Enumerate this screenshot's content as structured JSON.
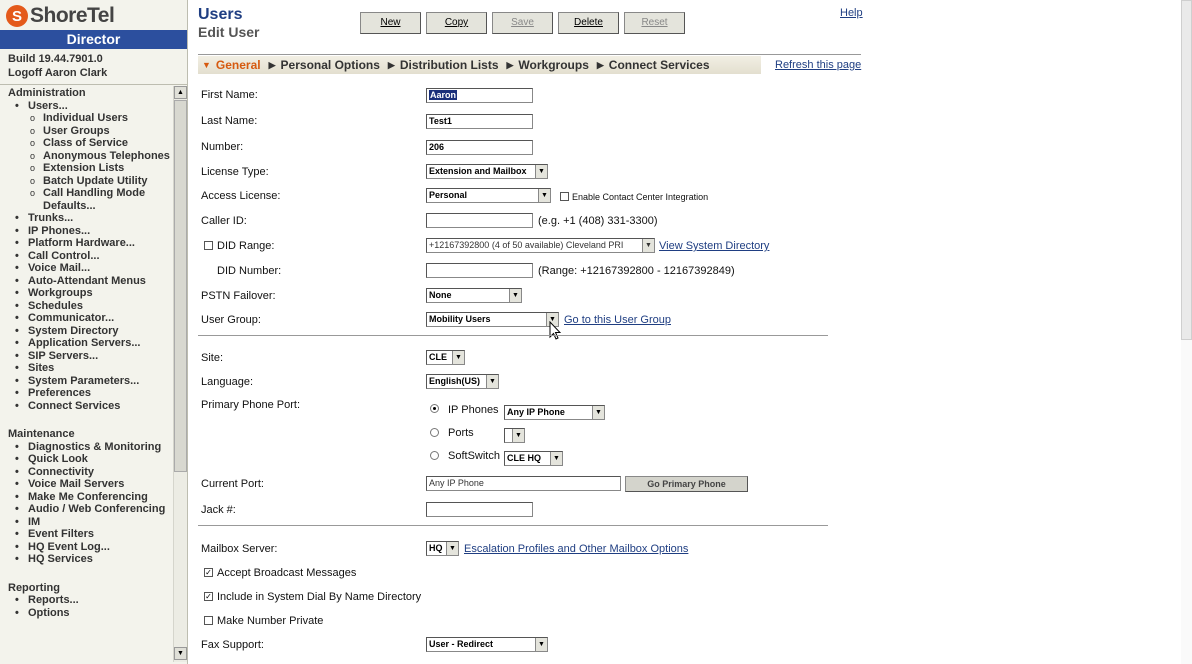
{
  "brand": {
    "logo_glyph": "S",
    "name": "ShoreTel",
    "product": "Director",
    "build": "Build 19.44.7901.0",
    "logoff": "Logoff Aaron Clark",
    "accent": "#2c4f9e",
    "logo_color": "#e45a1b"
  },
  "nav": {
    "administration": {
      "title": "Administration",
      "items": [
        {
          "label": "Users...",
          "children": [
            "Individual Users",
            "User Groups",
            "Class of Service",
            "Anonymous Telephones",
            "Extension Lists",
            "Batch Update Utility",
            "Call Handling Mode Defaults..."
          ]
        },
        {
          "label": "Trunks..."
        },
        {
          "label": "IP Phones..."
        },
        {
          "label": "Platform Hardware..."
        },
        {
          "label": "Call Control..."
        },
        {
          "label": "Voice Mail..."
        },
        {
          "label": "Auto-Attendant Menus"
        },
        {
          "label": "Workgroups"
        },
        {
          "label": "Schedules"
        },
        {
          "label": "Communicator..."
        },
        {
          "label": "System Directory"
        },
        {
          "label": "Application Servers..."
        },
        {
          "label": "SIP Servers..."
        },
        {
          "label": "Sites"
        },
        {
          "label": "System Parameters..."
        },
        {
          "label": "Preferences"
        },
        {
          "label": "Connect Services"
        }
      ]
    },
    "maintenance": {
      "title": "Maintenance",
      "items": [
        "Diagnostics & Monitoring",
        "Quick Look",
        "Connectivity",
        "Voice Mail Servers",
        "Make Me Conferencing",
        "Audio / Web Conferencing",
        "IM",
        "Event Filters",
        "HQ Event Log...",
        "HQ Services"
      ]
    },
    "reporting": {
      "title": "Reporting",
      "items": [
        "Reports...",
        "Options"
      ]
    }
  },
  "header": {
    "title": "Users",
    "subtitle": "Edit User",
    "help": "Help"
  },
  "toolbar": {
    "new": "New",
    "copy": "Copy",
    "save": "Save",
    "delete": "Delete",
    "reset": "Reset"
  },
  "tabs": [
    "General",
    "Personal Options",
    "Distribution Lists",
    "Workgroups",
    "Connect Services"
  ],
  "refresh": "Refresh this page",
  "form": {
    "first_name": {
      "label": "First Name:",
      "value": "Aaron"
    },
    "last_name": {
      "label": "Last Name:",
      "value": "Test1"
    },
    "number": {
      "label": "Number:",
      "value": "206"
    },
    "license_type": {
      "label": "License Type:",
      "value": "Extension and Mailbox"
    },
    "access_license": {
      "label": "Access License:",
      "value": "Personal",
      "cc_label": "Enable Contact Center Integration"
    },
    "caller_id": {
      "label": "Caller ID:",
      "value": "",
      "hint": "(e.g. +1 (408) 331-3300)"
    },
    "did_range": {
      "label": "DID Range:",
      "value": "+12167392800 (4 of 50 available) Cleveland PRI",
      "link": "View System Directory"
    },
    "did_number": {
      "label": "DID Number:",
      "value": "",
      "hint": "(Range: +12167392800 - 12167392849)"
    },
    "pstn_failover": {
      "label": "PSTN Failover:",
      "value": "None"
    },
    "user_group": {
      "label": "User Group:",
      "value": "Mobility Users",
      "link": "Go to this User Group"
    },
    "site": {
      "label": "Site:",
      "value": "CLE"
    },
    "language": {
      "label": "Language:",
      "value": "English(US)"
    },
    "primary_port": {
      "label": "Primary Phone Port:",
      "ip_phones": {
        "label": "IP Phones",
        "value": "Any IP Phone"
      },
      "ports": {
        "label": "Ports",
        "value": ""
      },
      "softswitch": {
        "label": "SoftSwitch",
        "value": "CLE HQ"
      }
    },
    "current_port": {
      "label": "Current Port:",
      "value": "Any IP Phone",
      "button": "Go Primary Phone"
    },
    "jack": {
      "label": "Jack #:",
      "value": ""
    },
    "mailbox_server": {
      "label": "Mailbox Server:",
      "value": "HQ",
      "link": "Escalation Profiles and Other Mailbox Options"
    },
    "accept_broadcast": {
      "label": "Accept Broadcast Messages"
    },
    "include_dial_by_name": {
      "label": "Include in System Dial By Name Directory"
    },
    "make_private": {
      "label": "Make Number Private"
    },
    "fax_support": {
      "label": "Fax Support:",
      "value": "User - Redirect"
    }
  },
  "glyphs": {
    "down": "▼",
    "up": "▲",
    "tab_active": "▼",
    "tab": "▶",
    "check": "✓"
  }
}
